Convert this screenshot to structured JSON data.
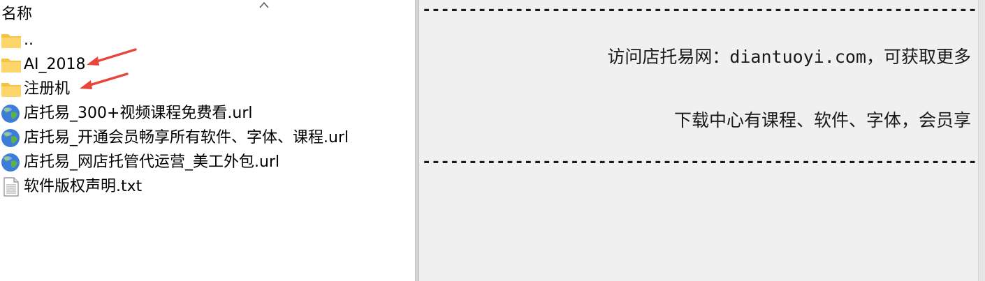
{
  "file_list": {
    "column_header": "名称",
    "items": [
      {
        "name": "..",
        "icon": "folder-icon"
      },
      {
        "name": "AI_2018",
        "icon": "folder-icon"
      },
      {
        "name": "注册机",
        "icon": "folder-icon"
      },
      {
        "name": "店托易_300+视频课程免费看.url",
        "icon": "globe-icon"
      },
      {
        "name": "店托易_开通会员畅享所有软件、字体、课程.url",
        "icon": "globe-icon"
      },
      {
        "name": "店托易_网店托管代运营_美工外包.url",
        "icon": "globe-icon"
      },
      {
        "name": "软件版权声明.txt",
        "icon": "text-file-icon"
      }
    ]
  },
  "preview": {
    "dash_top": "------------------------------------------------------------------------",
    "line1": "访问店托易网：diantuoyi.com，可获取更多",
    "line2": "下载中心有课程、软件、字体，会员享",
    "dash_bottom": "------------------------------------------------------------------------"
  },
  "colors": {
    "folder": "#f5c242",
    "arrow": "#e8453c",
    "preview_bg": "#f0f0f0"
  }
}
